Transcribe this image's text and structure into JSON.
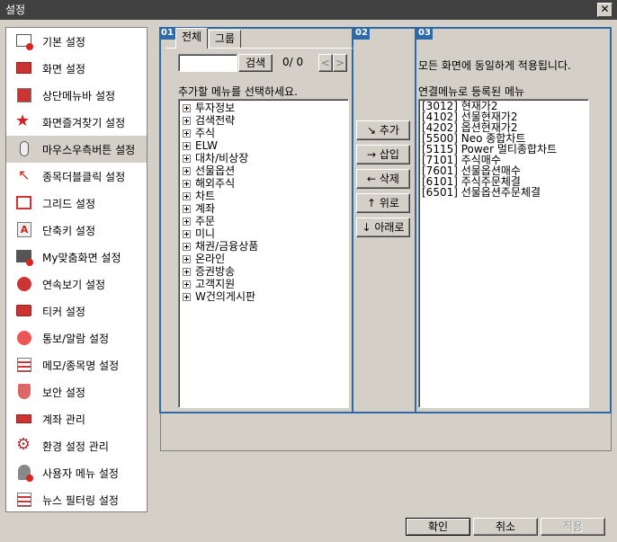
{
  "window": {
    "title": "설정",
    "close_glyph": "✕"
  },
  "sidebar": {
    "items": [
      {
        "label": "기본 설정",
        "icon": "monitor-badge-icon"
      },
      {
        "label": "화면 설정",
        "icon": "screen-icon"
      },
      {
        "label": "상단메뉴바 설정",
        "icon": "menubar-icon"
      },
      {
        "label": "화면즐겨찾기 설정",
        "icon": "star-icon"
      },
      {
        "label": "마우스우측버튼 설정",
        "icon": "mouse-icon"
      },
      {
        "label": "종목더블클릭 설정",
        "icon": "cursor-icon"
      },
      {
        "label": "그리드 설정",
        "icon": "grid-icon"
      },
      {
        "label": "단축키 설정",
        "icon": "shortcut-icon"
      },
      {
        "label": "My맞춤화면 설정",
        "icon": "custom-screen-icon"
      },
      {
        "label": "연속보기 설정",
        "icon": "search-icon"
      },
      {
        "label": "티커 설정",
        "icon": "ticker-icon"
      },
      {
        "label": "통보/알람 설정",
        "icon": "alarm-icon"
      },
      {
        "label": "메모/종목명 설정",
        "icon": "memo-icon"
      },
      {
        "label": "보안 설정",
        "icon": "shield-icon"
      },
      {
        "label": "계좌 관리",
        "icon": "account-icon"
      },
      {
        "label": "환경 설정 관리",
        "icon": "gear-icon"
      },
      {
        "label": "사용자 메뉴 설정",
        "icon": "user-icon"
      },
      {
        "label": "뉴스 필터링 설정",
        "icon": "news-icon"
      }
    ],
    "selected_index": 4
  },
  "sections": {
    "s1": "01",
    "s2": "02",
    "s3": "03"
  },
  "tabs": {
    "all": "전체",
    "group": "그룹"
  },
  "search": {
    "value": "",
    "button": "검색",
    "counter": "0/ 0",
    "prev": "<",
    "next": ">"
  },
  "menu_tree": {
    "label": "추가할 메뉴를 선택하세요.",
    "items": [
      "투자정보",
      "검색전략",
      "주식",
      "ELW",
      "대차/비상장",
      "선물옵션",
      "해외주식",
      "차트",
      "계좌",
      "주문",
      "미니",
      "채권/금융상품",
      "온라인",
      "증권방송",
      "고객지원",
      "W건의게시판"
    ]
  },
  "actions": {
    "add": "↘ 추가",
    "insert": "→ 삽입",
    "delete": "← 삭제",
    "up": "↑ 위로",
    "down": "↓ 아래로"
  },
  "registered": {
    "note": "모든 화면에 동일하게 적용됩니다.",
    "label": "연결메뉴로 등록된 메뉴",
    "items": [
      "[3012] 현재가2",
      "[4102] 선물현재가2",
      "[4202] 옵션현재가2",
      "[5500] Neo 종합차트",
      "[5115] Power 멀티종합차트",
      "[7101] 주식매수",
      "[7601] 선물옵션매수",
      "[6101] 주식주문체결",
      "[6501] 선물옵션주문체결"
    ]
  },
  "footer": {
    "ok": "확인",
    "cancel": "취소",
    "apply": "적용"
  },
  "colors": {
    "section_border": "#2e6aa8",
    "titlebar": "#404040",
    "background": "#d4d0c8"
  }
}
